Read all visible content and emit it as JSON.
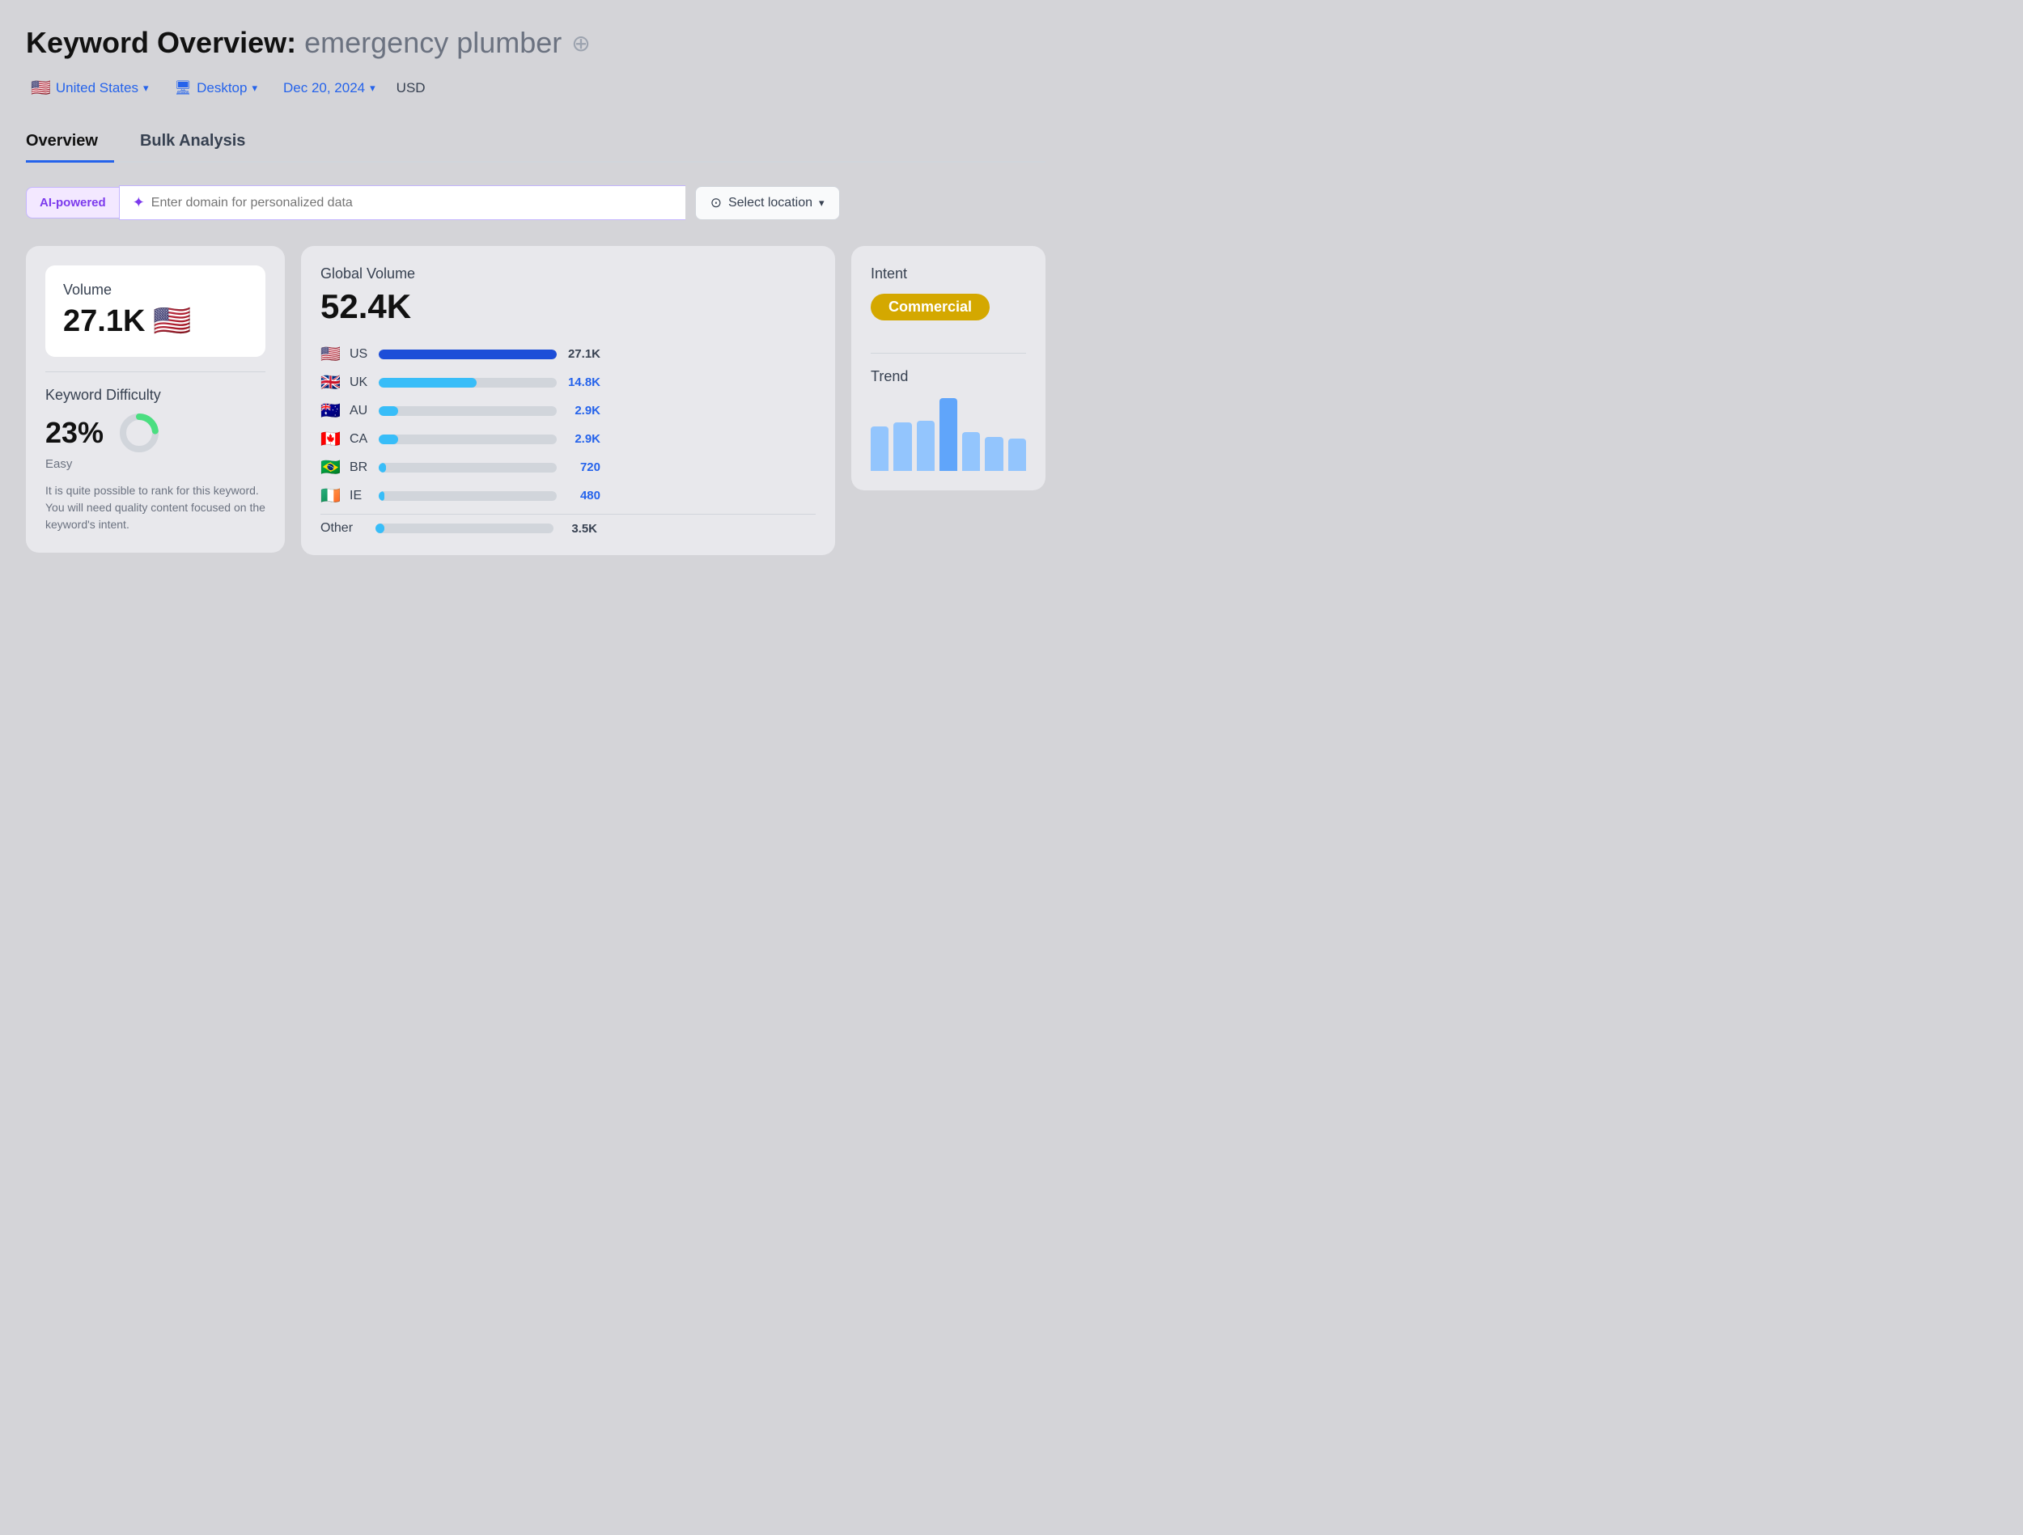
{
  "header": {
    "title_prefix": "Keyword Overview:",
    "title_keyword": "emergency plumber",
    "add_icon": "⊕"
  },
  "toolbar": {
    "location": "United States",
    "location_flag": "🇺🇸",
    "device": "Desktop",
    "device_icon": "🖥",
    "date": "Dec 20, 2024",
    "currency": "USD"
  },
  "tabs": [
    {
      "label": "Overview",
      "active": true
    },
    {
      "label": "Bulk Analysis",
      "active": false
    }
  ],
  "ai_bar": {
    "badge_label": "AI-powered",
    "input_placeholder": "Enter domain for personalized data",
    "sparkle_icon": "✦",
    "location_icon": "⊙",
    "select_location_label": "Select location",
    "select_location_count": "0"
  },
  "left_card": {
    "volume_label": "Volume",
    "volume_value": "27.1K",
    "volume_flag": "🇺🇸",
    "kd_label": "Keyword Difficulty",
    "kd_percent": "23%",
    "kd_difficulty": "Easy",
    "kd_desc": "It is quite possible to rank for this keyword. You will need quality content focused on the keyword's intent.",
    "donut_percent": 23,
    "donut_color": "#4ade80",
    "donut_bg": "#d1d5db"
  },
  "middle_card": {
    "global_label": "Global Volume",
    "global_value": "52.4K",
    "countries": [
      {
        "flag": "🇺🇸",
        "code": "US",
        "volume": "27.1K",
        "bar_pct": 100,
        "color": "#1d4ed8",
        "dark": true
      },
      {
        "flag": "🇬🇧",
        "code": "UK",
        "volume": "14.8K",
        "bar_pct": 55,
        "color": "#38bdf8",
        "dark": false
      },
      {
        "flag": "🇦🇺",
        "code": "AU",
        "volume": "2.9K",
        "bar_pct": 11,
        "color": "#38bdf8",
        "dark": false
      },
      {
        "flag": "🇨🇦",
        "code": "CA",
        "volume": "2.9K",
        "bar_pct": 11,
        "color": "#38bdf8",
        "dark": false
      },
      {
        "flag": "🇧🇷",
        "code": "BR",
        "volume": "720",
        "bar_pct": 4,
        "color": "#38bdf8",
        "dark": false
      },
      {
        "flag": "🇮🇪",
        "code": "IE",
        "volume": "480",
        "bar_pct": 3,
        "color": "#38bdf8",
        "dark": false
      }
    ],
    "other_label": "Other",
    "other_volume": "3.5K",
    "other_bar_pct": 5,
    "other_color": "#38bdf8"
  },
  "right_card": {
    "intent_label": "Intent",
    "intent_badge": "Commercial",
    "trend_label": "Trend",
    "trend_bars": [
      {
        "height": 55,
        "color": "#93c5fd"
      },
      {
        "height": 60,
        "color": "#93c5fd"
      },
      {
        "height": 62,
        "color": "#93c5fd"
      },
      {
        "height": 90,
        "color": "#60a5fa"
      },
      {
        "height": 48,
        "color": "#93c5fd"
      },
      {
        "height": 42,
        "color": "#93c5fd"
      },
      {
        "height": 40,
        "color": "#93c5fd"
      }
    ]
  }
}
